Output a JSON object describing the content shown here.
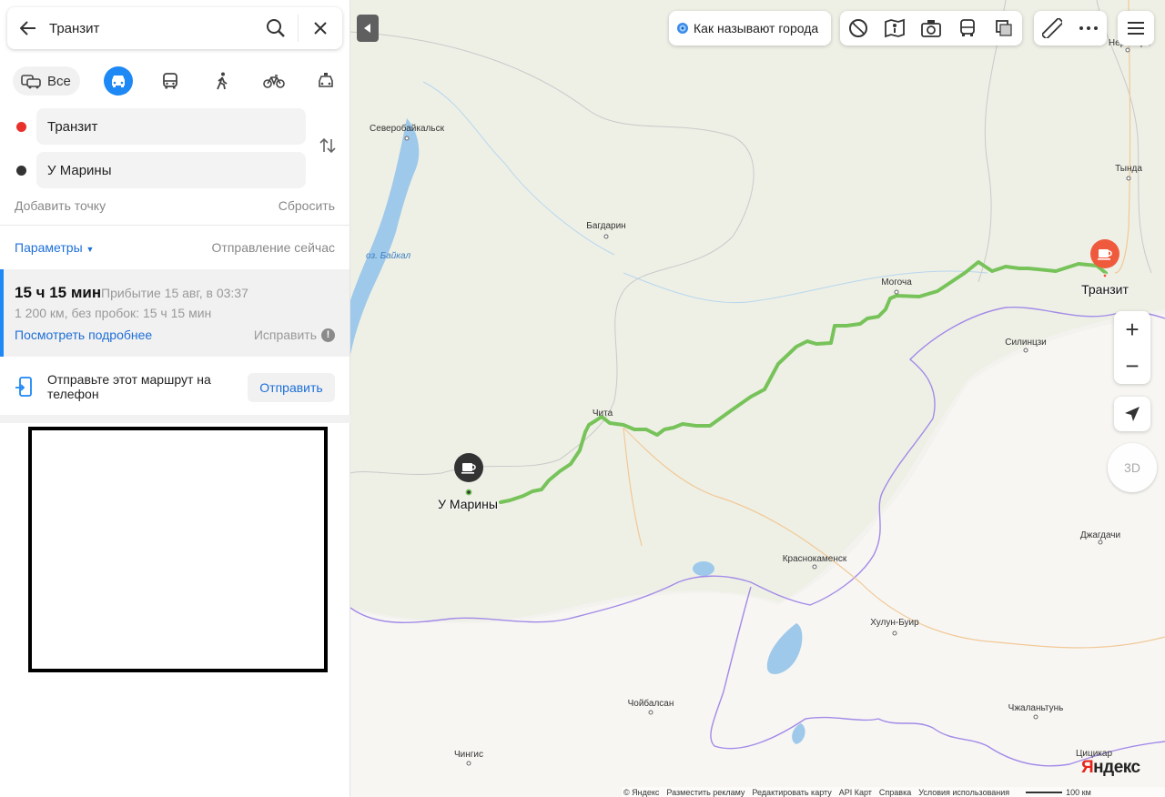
{
  "search": {
    "query": "Транзит"
  },
  "modes": {
    "all_label": "Все"
  },
  "route_points": {
    "from": "Транзит",
    "to": "У Марины"
  },
  "actions": {
    "add_point": "Добавить точку",
    "reset": "Сбросить"
  },
  "params": {
    "label": "Параметры",
    "departure": "Отправление сейчас"
  },
  "route": {
    "duration": "15 ч 15 мин",
    "arrival": "Прибытие 15 авг, в 03:37",
    "distance": "1 200 км, без пробок: 15 ч 15 мин",
    "details_link": "Посмотреть подробнее",
    "fix_label": "Исправить"
  },
  "send": {
    "text": "Отправьте этот маршрут на телефон",
    "button": "Отправить"
  },
  "toolbar": {
    "cities_button": "Как называют города"
  },
  "map": {
    "cities": [
      "Северобайкальск",
      "Багдарин",
      "Могоча",
      "Тында",
      "Нерюнгри",
      "Силинцзи",
      "Чита",
      "Краснокаменск",
      "Джагдачи",
      "Хулун-Буир",
      "Чойбалсан",
      "Чжаланьтунь",
      "Чингис",
      "Цицикар"
    ],
    "lake_label": "оз. Байкал",
    "start_label": "Транзит",
    "end_label": "У Марины",
    "route_color": "#77c35a",
    "start_marker_color": "#f05a3c",
    "end_marker_color": "#333333"
  },
  "controls": {
    "zoom_in": "+",
    "zoom_out": "−",
    "three_d": "3D"
  },
  "footer": {
    "links": [
      "© Яндекс",
      "Разместить рекламу",
      "Редактировать карту",
      "API Карт",
      "Справка",
      "Условия использования"
    ],
    "scale": "100 км"
  },
  "logo": {
    "y": "Я",
    "rest": "ндекс"
  },
  "colors": {
    "accent": "#1e88f5",
    "link": "#1e6fd9"
  }
}
